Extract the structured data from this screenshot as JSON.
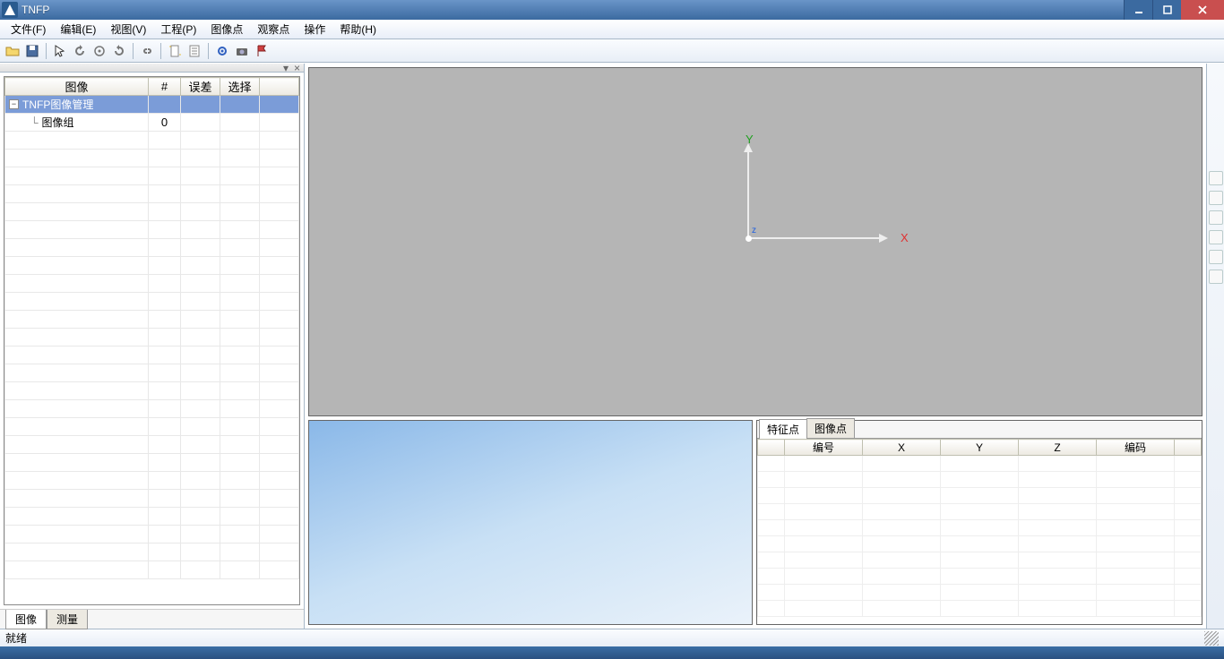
{
  "title": "TNFP",
  "menu": {
    "file": "文件(F)",
    "edit": "编辑(E)",
    "view": "视图(V)",
    "project": "工程(P)",
    "imgpt": "图像点",
    "obspt": "观察点",
    "operate": "操作",
    "help": "帮助(H)"
  },
  "left": {
    "close_glyph": "×",
    "pin_glyph": "▾",
    "headers": {
      "image": "图像",
      "count": "#",
      "error": "误差",
      "select": "选择"
    },
    "root": "TNFP图像管理",
    "group": "图像组",
    "group_count": "0",
    "expander": "−",
    "tabs": {
      "image": "图像",
      "measure": "测量"
    }
  },
  "viewport": {
    "x": "X",
    "y": "Y",
    "z": "z"
  },
  "points": {
    "tabs": {
      "feature": "特征点",
      "image": "图像点"
    },
    "headers": {
      "id": "编号",
      "x": "X",
      "y": "Y",
      "z": "Z",
      "code": "编码"
    }
  },
  "status": "就绪"
}
